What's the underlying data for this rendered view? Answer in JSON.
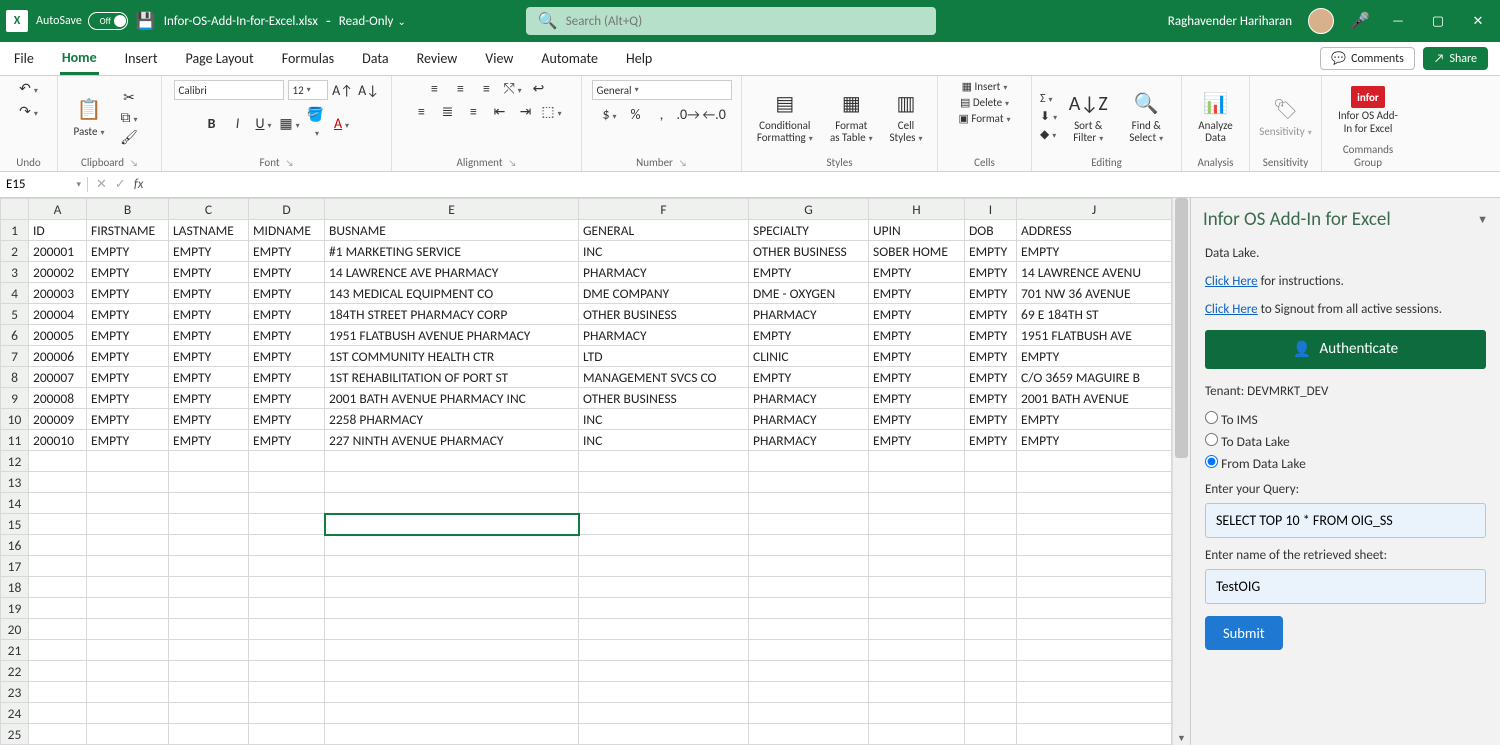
{
  "titlebar": {
    "autosave_label": "AutoSave",
    "autosave_state": "Off",
    "doc_name": "Infor-OS-Add-In-for-Excel.xlsx",
    "readonly": "Read-Only",
    "search_placeholder": "Search (Alt+Q)",
    "user_name": "Raghavender Hariharan"
  },
  "tabs": {
    "items": [
      "File",
      "Home",
      "Insert",
      "Page Layout",
      "Formulas",
      "Data",
      "Review",
      "View",
      "Automate",
      "Help"
    ],
    "active": "Home",
    "comments": "Comments",
    "share": "Share"
  },
  "ribbon": {
    "undo": "Undo",
    "clipboard": {
      "paste": "Paste",
      "label": "Clipboard"
    },
    "font": {
      "name": "Calibri",
      "size": "12",
      "label": "Font"
    },
    "alignment": {
      "label": "Alignment"
    },
    "number": {
      "format": "General",
      "label": "Number"
    },
    "styles": {
      "cond": "Conditional Formatting",
      "table": "Format as Table",
      "cell": "Cell Styles",
      "label": "Styles"
    },
    "cells": {
      "insert": "Insert",
      "delete": "Delete",
      "format": "Format",
      "label": "Cells"
    },
    "editing": {
      "sort": "Sort & Filter",
      "find": "Find & Select",
      "label": "Editing"
    },
    "analysis": {
      "analyze": "Analyze Data",
      "label": "Analysis"
    },
    "sensitivity": {
      "btn": "Sensitivity",
      "label": "Sensitivity"
    },
    "commands": {
      "btn": "Infor OS Add-In for Excel",
      "label": "Commands Group"
    }
  },
  "fx": {
    "cell": "E15"
  },
  "columns": [
    "A",
    "B",
    "C",
    "D",
    "E",
    "F",
    "G",
    "H",
    "I",
    "J"
  ],
  "header_row": [
    "ID",
    "FIRSTNAME",
    "LASTNAME",
    "MIDNAME",
    "BUSNAME",
    "GENERAL",
    "SPECIALTY",
    "UPIN",
    "DOB",
    "ADDRESS"
  ],
  "rows": [
    [
      "200001",
      "EMPTY",
      "EMPTY",
      "EMPTY",
      "#1 MARKETING SERVICE",
      "INC",
      "OTHER BUSINESS",
      "SOBER HOME",
      "EMPTY",
      "EMPTY"
    ],
    [
      "200002",
      "EMPTY",
      "EMPTY",
      "EMPTY",
      "14 LAWRENCE AVE PHARMACY",
      "PHARMACY",
      "EMPTY",
      "EMPTY",
      "EMPTY",
      "14 LAWRENCE AVENU"
    ],
    [
      "200003",
      "EMPTY",
      "EMPTY",
      "EMPTY",
      "143 MEDICAL EQUIPMENT CO",
      "DME COMPANY",
      "DME - OXYGEN",
      "EMPTY",
      "EMPTY",
      "701 NW 36 AVENUE"
    ],
    [
      "200004",
      "EMPTY",
      "EMPTY",
      "EMPTY",
      "184TH STREET PHARMACY CORP",
      "OTHER BUSINESS",
      "PHARMACY",
      "EMPTY",
      "EMPTY",
      "69 E 184TH ST"
    ],
    [
      "200005",
      "EMPTY",
      "EMPTY",
      "EMPTY",
      "1951 FLATBUSH AVENUE PHARMACY",
      "PHARMACY",
      "EMPTY",
      "EMPTY",
      "EMPTY",
      "1951 FLATBUSH AVE"
    ],
    [
      "200006",
      "EMPTY",
      "EMPTY",
      "EMPTY",
      "1ST COMMUNITY HEALTH CTR",
      "LTD",
      "CLINIC",
      "EMPTY",
      "EMPTY",
      "EMPTY"
    ],
    [
      "200007",
      "EMPTY",
      "EMPTY",
      "EMPTY",
      "1ST REHABILITATION OF PORT ST",
      "MANAGEMENT SVCS CO",
      "EMPTY",
      "EMPTY",
      "EMPTY",
      "C/O 3659 MAGUIRE B"
    ],
    [
      "200008",
      "EMPTY",
      "EMPTY",
      "EMPTY",
      "2001 BATH AVENUE PHARMACY INC",
      "OTHER BUSINESS",
      "PHARMACY",
      "EMPTY",
      "EMPTY",
      "2001 BATH AVENUE"
    ],
    [
      "200009",
      "EMPTY",
      "EMPTY",
      "EMPTY",
      "2258 PHARMACY",
      "INC",
      "PHARMACY",
      "EMPTY",
      "EMPTY",
      "EMPTY"
    ],
    [
      "200010",
      "EMPTY",
      "EMPTY",
      "EMPTY",
      "227 NINTH AVENUE PHARMACY",
      "INC",
      "PHARMACY",
      "EMPTY",
      "EMPTY",
      "EMPTY"
    ]
  ],
  "empty_rows": 14,
  "selected_cell": {
    "row": 15,
    "col": "E"
  },
  "taskpane": {
    "title": "Infor OS Add-In for Excel",
    "datalake_line": "Data Lake.",
    "instr_link": "Click Here",
    "instr_rest": " for instructions.",
    "signout_link": "Click Here",
    "signout_rest": " to Signout from all active sessions.",
    "auth_btn": "Authenticate",
    "tenant_label": "Tenant: DEVMRKT_DEV",
    "radio_ims": "To IMS",
    "radio_to_dl": "To Data Lake",
    "radio_from_dl": "From Data Lake",
    "query_label": "Enter your Query:",
    "query_value": "SELECT TOP 10 * FROM OIG_SS",
    "sheet_label": "Enter name of the retrieved sheet:",
    "sheet_value": "TestOIG",
    "submit": "Submit"
  }
}
